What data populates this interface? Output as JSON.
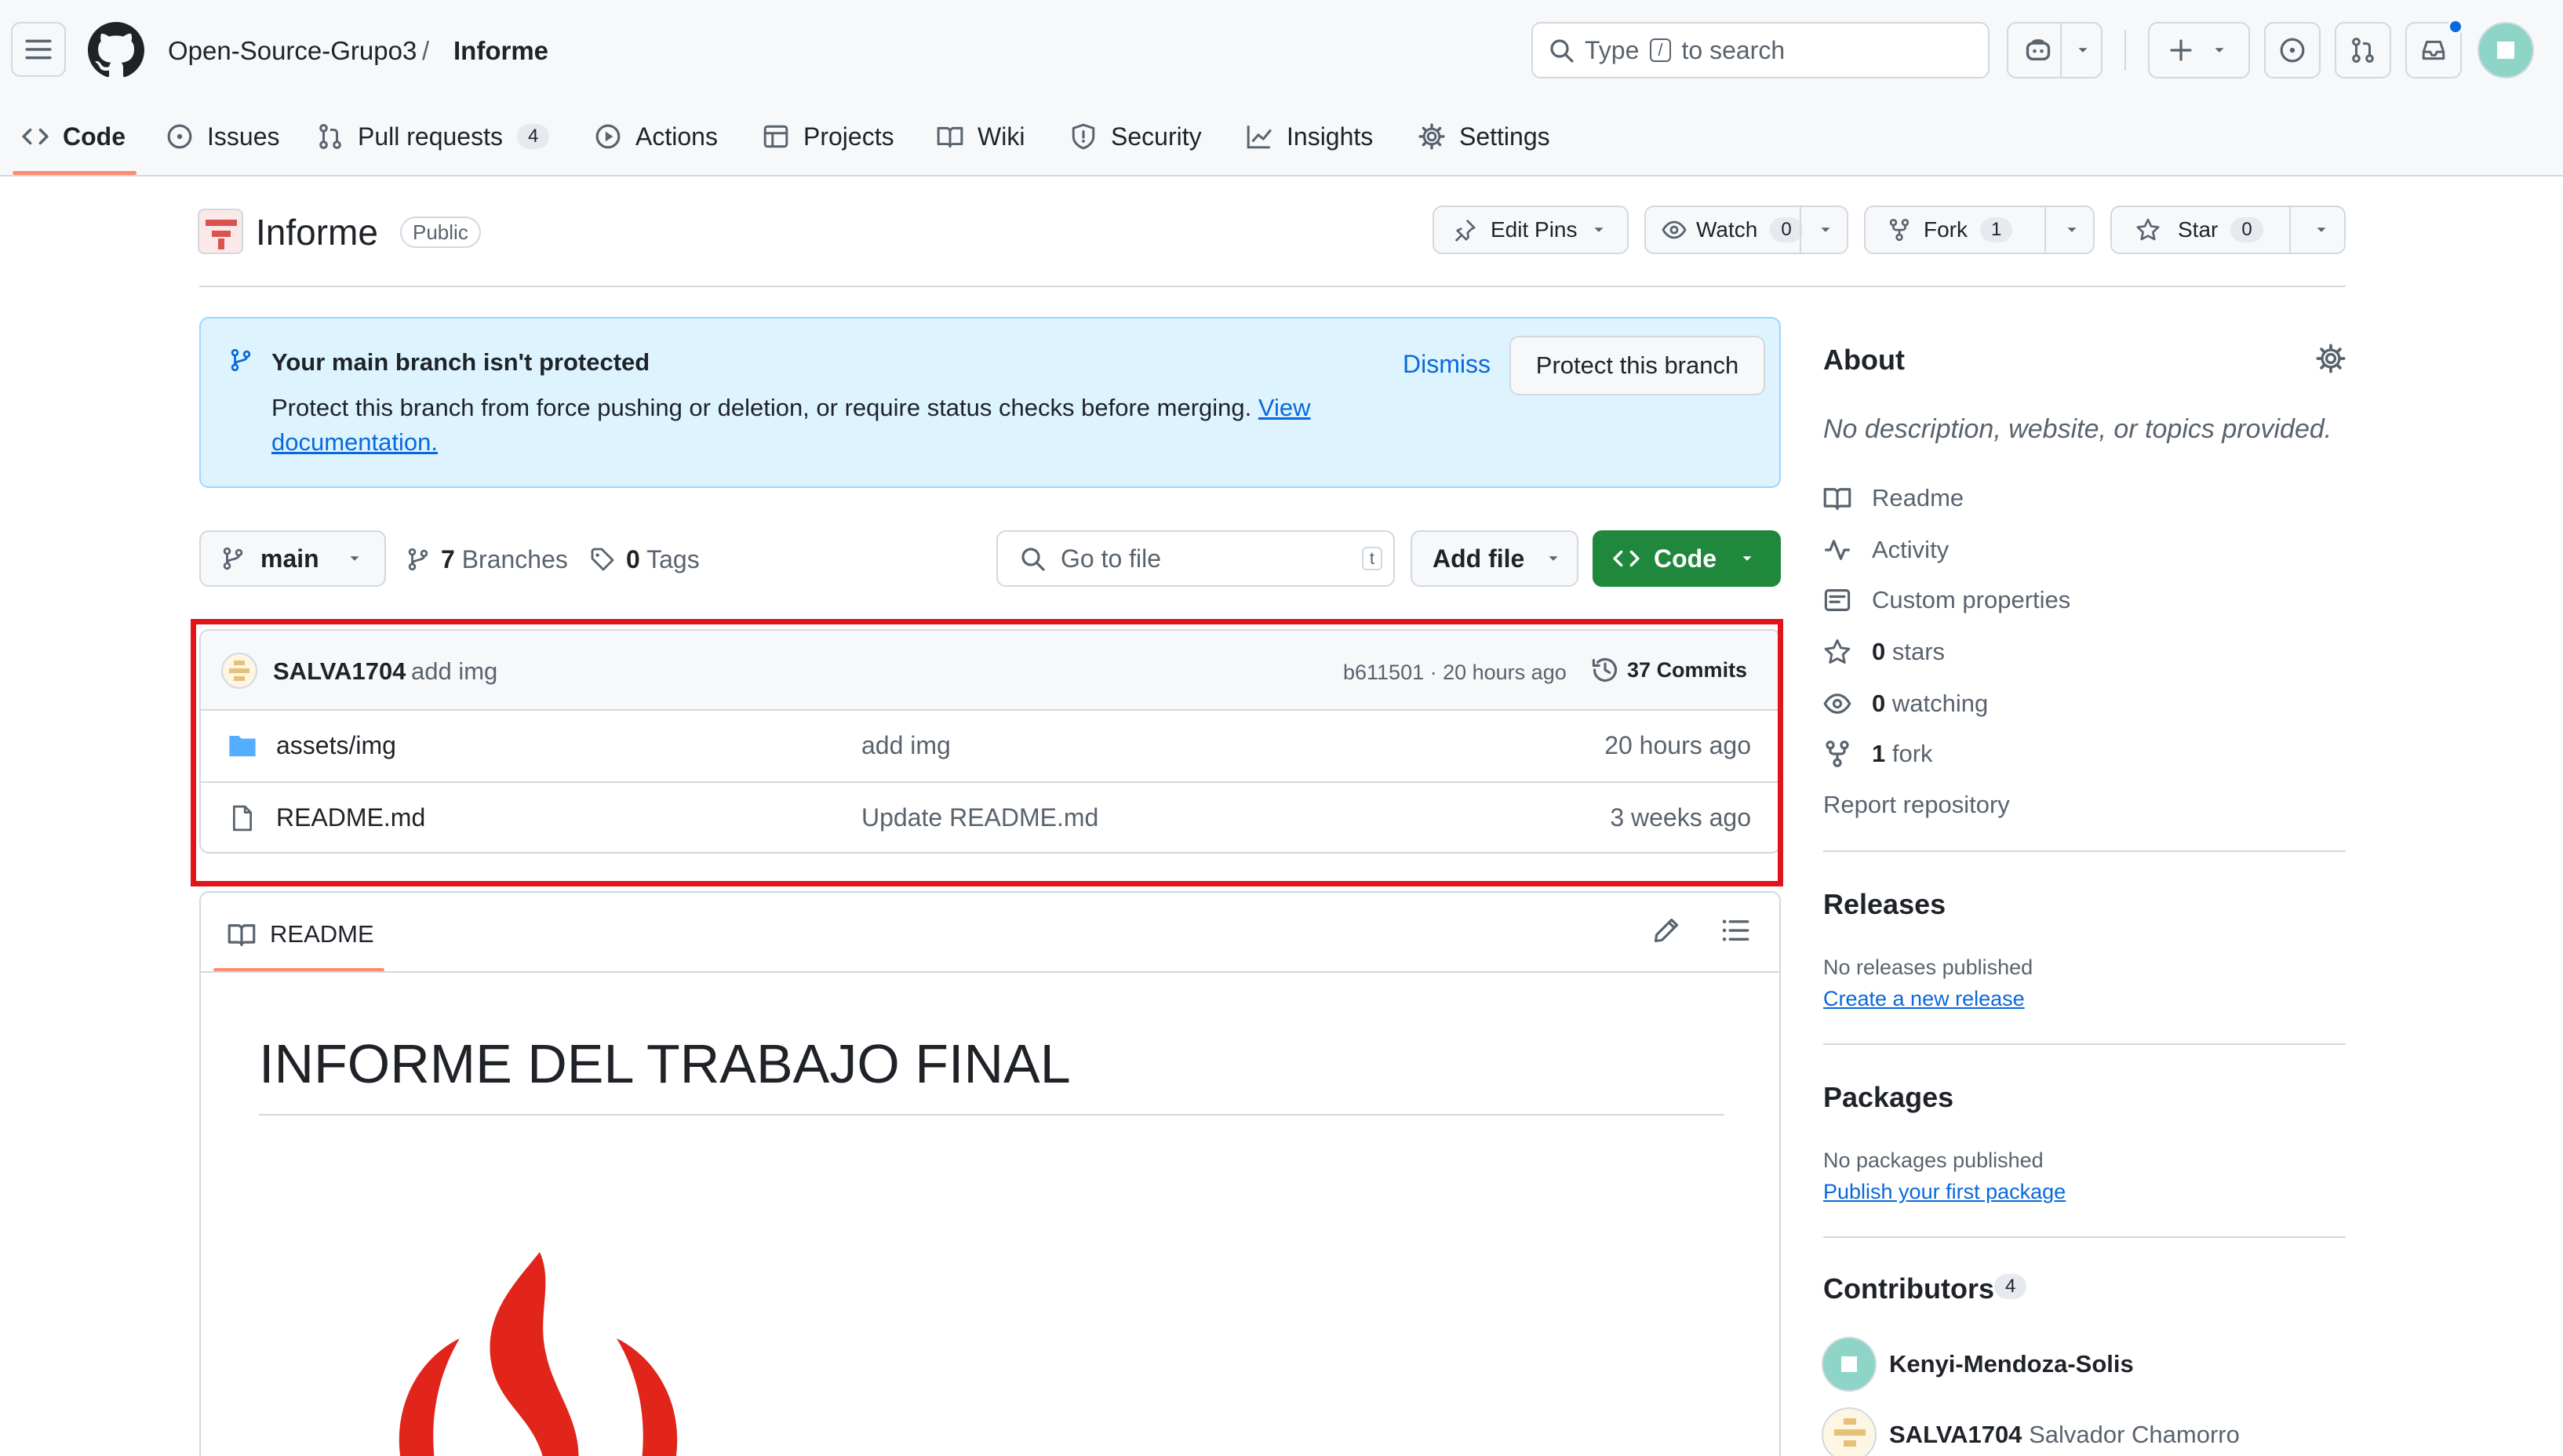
{
  "header": {
    "org": "Open-Source-Grupo3",
    "separator": "/",
    "repo": "Informe",
    "search_prefix": "Type",
    "search_key": "/",
    "search_suffix": "to search"
  },
  "tabs": [
    {
      "label": "Code",
      "icon": "code-icon"
    },
    {
      "label": "Issues",
      "icon": "issue-icon"
    },
    {
      "label": "Pull requests",
      "icon": "pull-request-icon",
      "count": "4"
    },
    {
      "label": "Actions",
      "icon": "play-icon"
    },
    {
      "label": "Projects",
      "icon": "table-icon"
    },
    {
      "label": "Wiki",
      "icon": "book-icon"
    },
    {
      "label": "Security",
      "icon": "shield-icon"
    },
    {
      "label": "Insights",
      "icon": "graph-icon"
    },
    {
      "label": "Settings",
      "icon": "gear-icon"
    }
  ],
  "repo_head": {
    "name": "Informe",
    "visibility": "Public",
    "edit_pins": "Edit Pins",
    "watch": "Watch",
    "watch_count": "0",
    "fork": "Fork",
    "fork_count": "1",
    "star": "Star",
    "star_count": "0"
  },
  "banner": {
    "title": "Your main branch isn't protected",
    "text": "Protect this branch from force pushing or deletion, or require status checks before merging.",
    "link_1": "View",
    "link_2": "documentation.",
    "dismiss": "Dismiss",
    "protect": "Protect this branch"
  },
  "file_nav": {
    "branch": "main",
    "branches_count": "7",
    "branches_label": "Branches",
    "tags_count": "0",
    "tags_label": "Tags",
    "go_to_file_placeholder": "Go to file",
    "go_to_file_key": "t",
    "add_file": "Add file",
    "code": "Code"
  },
  "latest_commit": {
    "author": "SALVA1704",
    "message": "add img",
    "hash_time": "b611501 · 20 hours ago",
    "commits_count": "37",
    "commits_label": "Commits"
  },
  "files": [
    {
      "name": "assets/img",
      "type": "folder",
      "message": "add img",
      "age": "20 hours ago"
    },
    {
      "name": "README.md",
      "type": "file",
      "message": "Update README.md",
      "age": "3 weeks ago"
    }
  ],
  "readme": {
    "tab_label": "README",
    "heading": "INFORME DEL TRABAJO FINAL"
  },
  "about": {
    "title": "About",
    "description": "No description, website, or topics provided.",
    "items": [
      {
        "icon": "book-icon",
        "bold": "",
        "label": "Readme"
      },
      {
        "icon": "pulse-icon",
        "bold": "",
        "label": "Activity"
      },
      {
        "icon": "note-icon",
        "bold": "",
        "label": "Custom properties"
      },
      {
        "icon": "star-icon",
        "bold": "0",
        "label": "stars"
      },
      {
        "icon": "eye-icon",
        "bold": "0",
        "label": "watching"
      },
      {
        "icon": "fork-icon",
        "bold": "1",
        "label": "fork"
      }
    ],
    "report": "Report repository"
  },
  "releases": {
    "title": "Releases",
    "empty": "No releases published",
    "link": "Create a new release"
  },
  "packages": {
    "title": "Packages",
    "empty": "No packages published",
    "link": "Publish your first package"
  },
  "contributors": {
    "title": "Contributors",
    "count": "4",
    "list": [
      {
        "login": "Kenyi-Mendoza-Solis",
        "name": ""
      },
      {
        "login": "SALVA1704",
        "name": "Salvador Chamorro"
      }
    ]
  },
  "colors": {
    "accent_underline": "#fd8c73",
    "code_button": "#1f883d",
    "link": "#0969da",
    "highlight_box": "#e3131a",
    "banner_bg": "#ddf4ff"
  }
}
